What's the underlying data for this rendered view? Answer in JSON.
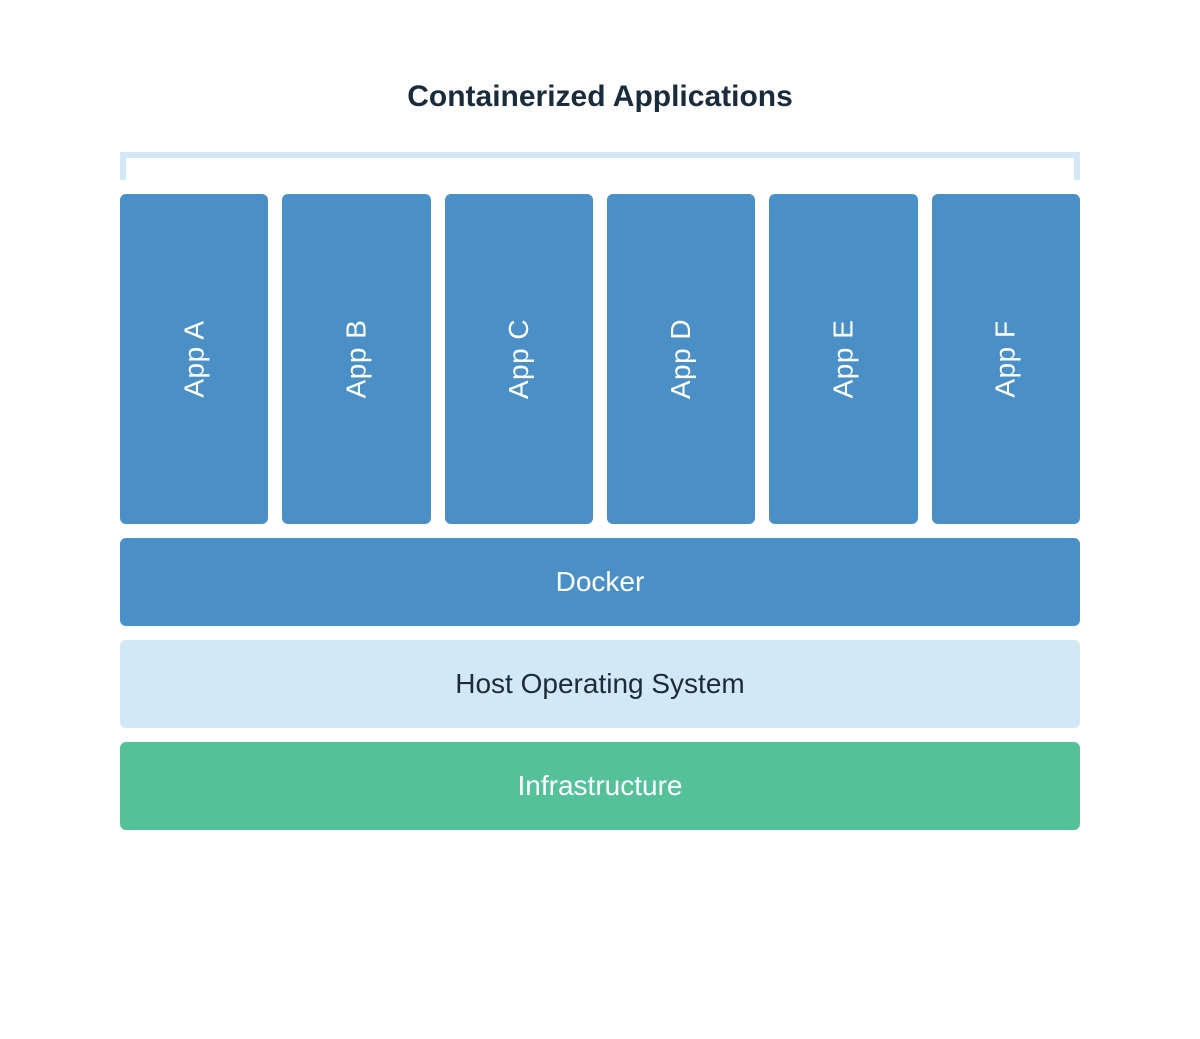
{
  "title": "Containerized Applications",
  "apps": [
    {
      "label": "App A"
    },
    {
      "label": "App B"
    },
    {
      "label": "App C"
    },
    {
      "label": "App D"
    },
    {
      "label": "App E"
    },
    {
      "label": "App F"
    }
  ],
  "layers": {
    "docker": "Docker",
    "host": "Host Operating System",
    "infra": "Infrastructure"
  },
  "colors": {
    "app_bg": "#4a90c6",
    "docker_bg": "#4a90c6",
    "host_bg": "#d3e8f6",
    "infra_bg": "#55c19a",
    "title_text": "#1a2b3c",
    "bracket": "#d3e8f6"
  }
}
